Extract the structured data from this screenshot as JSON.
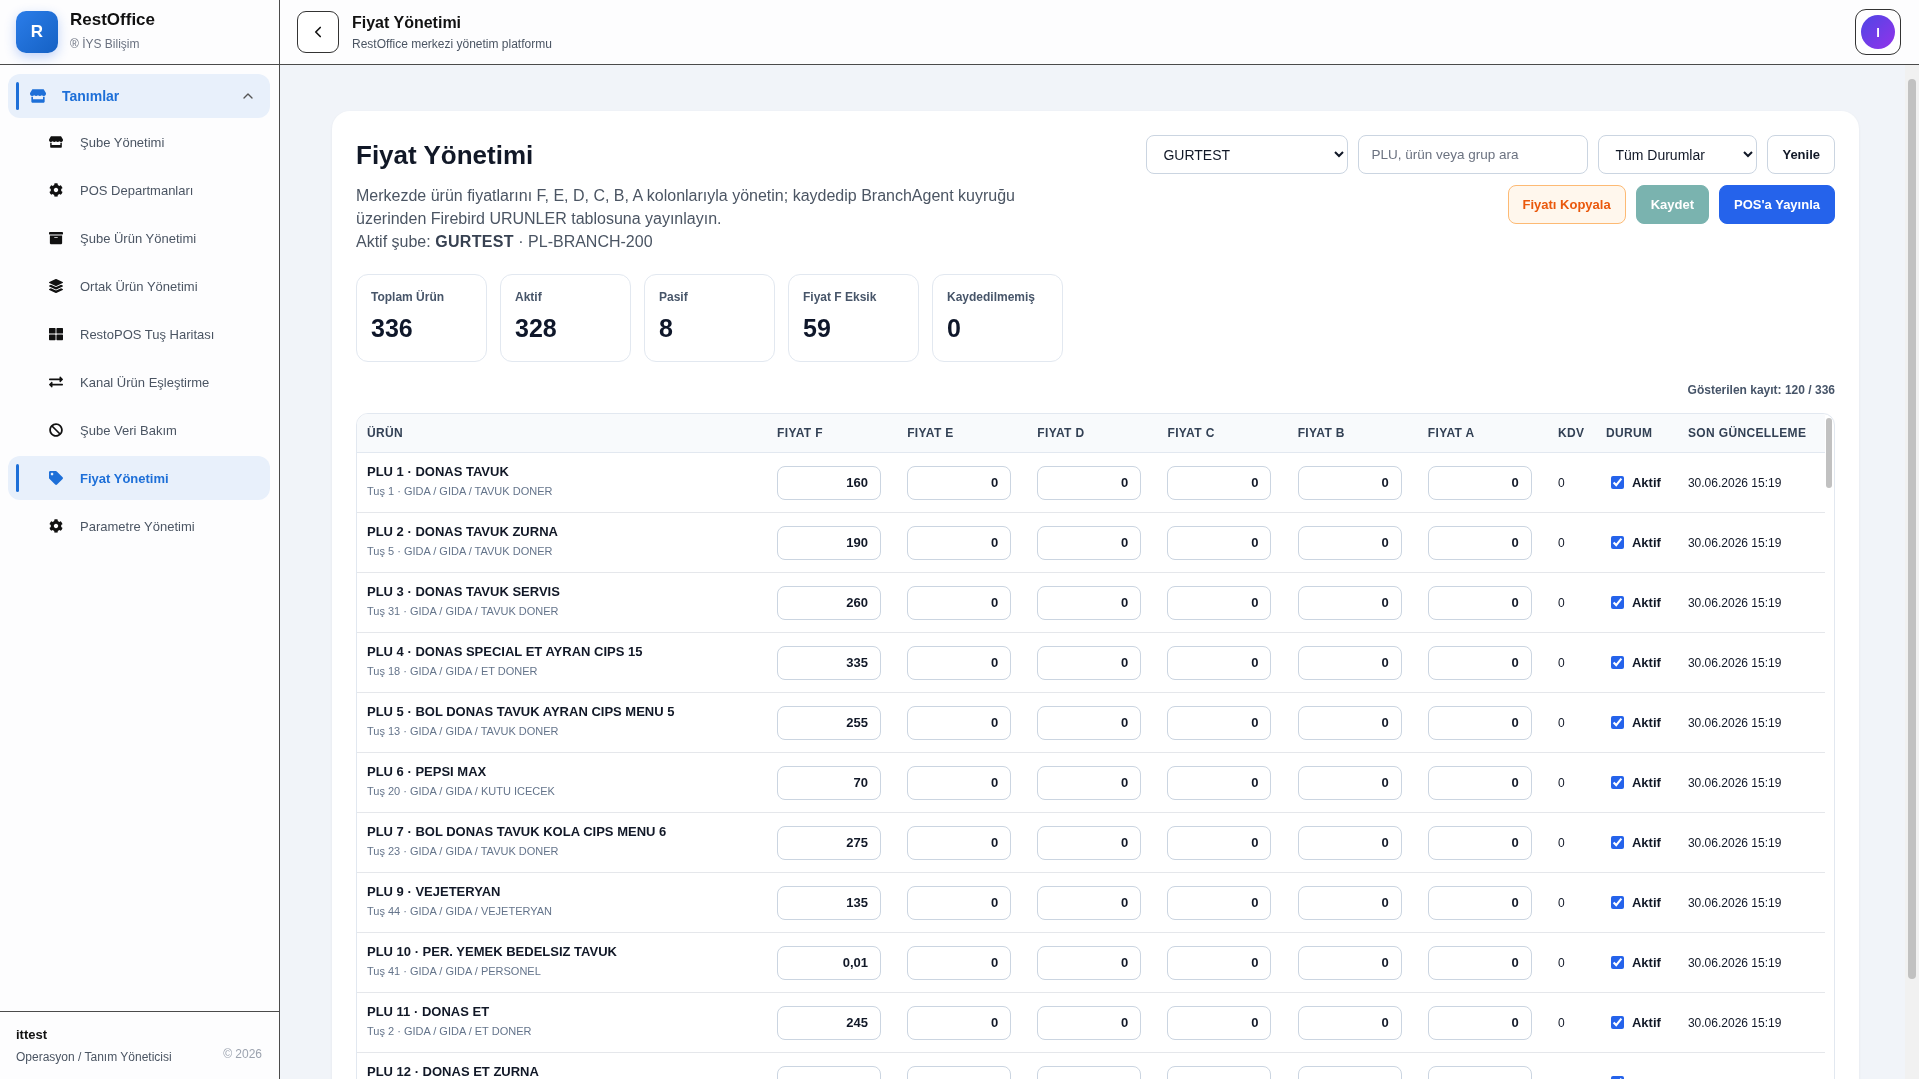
{
  "sidebar": {
    "brand": {
      "logo_letter": "R",
      "name": "RestOffice",
      "subtitle": "® İYS Bilişim"
    },
    "nav": [
      {
        "label": "Tanımlar",
        "selected": true,
        "expanded": true,
        "children": [
          {
            "label": "Şube Yönetimi",
            "selected": false
          },
          {
            "label": "POS Departmanları",
            "selected": false
          },
          {
            "label": "Şube Ürün Yönetimi",
            "selected": false
          },
          {
            "label": "Ortak Ürün Yönetimi",
            "selected": false
          },
          {
            "label": "RestoPOS Tuş Haritası",
            "selected": false
          },
          {
            "label": "Kanal Ürün Eşleştirme",
            "selected": false
          },
          {
            "label": "Şube Veri Bakım",
            "selected": false
          },
          {
            "label": "Fiyat Yönetimi",
            "selected": true
          },
          {
            "label": "Parametre Yönetimi",
            "selected": false
          }
        ]
      }
    ],
    "user": {
      "name": "ittest",
      "role": "Operasyon / Tanım Yöneticisi",
      "copyright": "© 2026"
    }
  },
  "topbar": {
    "title": "Fiyat Yönetimi",
    "subtitle": "RestOffice merkezi yönetim platformu",
    "avatar_initial": "I"
  },
  "page": {
    "title": "Fiyat Yönetimi",
    "description": "Merkezde ürün fiyatlarını F, E, D, C, B, A kolonlarıyla yönetin; kaydedip BranchAgent kuyruğu üzerinden Firebird URUNLER tablosuna yayınlayın.",
    "active_branch": "Aktif şube: **GURTEST** · PL-BRANCH-200",
    "filters": {
      "branch": "GURTEST",
      "search": {
        "placeholder": "PLU, ürün veya grup ara"
      },
      "status": "Tüm Durumlar",
      "refresh": "Yenile"
    },
    "actions": [
      {
        "label": "Fiyatı Kopyala",
        "kind": "outline",
        "disabled": false
      },
      {
        "label": "Kaydet",
        "kind": "success",
        "disabled": true
      },
      {
        "label": "POS'a Yayınla",
        "kind": "primary",
        "disabled": false
      }
    ],
    "stats": [
      {
        "label": "Toplam Ürün",
        "value": "336"
      },
      {
        "label": "Aktif",
        "value": "328"
      },
      {
        "label": "Pasif",
        "value": "8"
      },
      {
        "label": "Fiyat F Eksik",
        "value": "59"
      },
      {
        "label": "Kaydedilmemiş",
        "value": "0"
      }
    ],
    "record_count": "Gösterilen kayıt: 120 / 336",
    "table": {
      "columns": [
        "ÜRÜN",
        "FIYAT F",
        "FIYAT E",
        "FIYAT D",
        "FIYAT C",
        "FIYAT B",
        "FIYAT A",
        "KDV",
        "DURUM",
        "SON GÜNCELLEME"
      ],
      "rows": [
        {
          "name": "PLU 1 · DONAS TAVUK",
          "detail": "Tuş 1 · GIDA / GIDA / TAVUK DONER",
          "prices": [
            "160",
            "0",
            "0",
            "0",
            "0",
            "0"
          ],
          "kdv": "0",
          "checked": true,
          "status": "Aktif",
          "updated": "30.06.2026 15:19"
        },
        {
          "name": "PLU 2 · DONAS TAVUK ZURNA",
          "detail": "Tuş 5 · GIDA / GIDA / TAVUK DONER",
          "prices": [
            "190",
            "0",
            "0",
            "0",
            "0",
            "0"
          ],
          "kdv": "0",
          "checked": true,
          "status": "Aktif",
          "updated": "30.06.2026 15:19"
        },
        {
          "name": "PLU 3 · DONAS TAVUK SERVIS",
          "detail": "Tuş 31 · GIDA / GIDA / TAVUK DONER",
          "prices": [
            "260",
            "0",
            "0",
            "0",
            "0",
            "0"
          ],
          "kdv": "0",
          "checked": true,
          "status": "Aktif",
          "updated": "30.06.2026 15:19"
        },
        {
          "name": "PLU 4 · DONAS SPECIAL ET AYRAN CIPS 15",
          "detail": "Tuş 18 · GIDA / GIDA / ET DONER",
          "prices": [
            "335",
            "0",
            "0",
            "0",
            "0",
            "0"
          ],
          "kdv": "0",
          "checked": true,
          "status": "Aktif",
          "updated": "30.06.2026 15:19"
        },
        {
          "name": "PLU 5 · BOL DONAS TAVUK AYRAN CIPS MENU 5",
          "detail": "Tuş 13 · GIDA / GIDA / TAVUK DONER",
          "prices": [
            "255",
            "0",
            "0",
            "0",
            "0",
            "0"
          ],
          "kdv": "0",
          "checked": true,
          "status": "Aktif",
          "updated": "30.06.2026 15:19"
        },
        {
          "name": "PLU 6 · PEPSI MAX",
          "detail": "Tuş 20 · GIDA / GIDA / KUTU ICECEK",
          "prices": [
            "70",
            "0",
            "0",
            "0",
            "0",
            "0"
          ],
          "kdv": "0",
          "checked": true,
          "status": "Aktif",
          "updated": "30.06.2026 15:19"
        },
        {
          "name": "PLU 7 · BOL DONAS TAVUK KOLA CIPS MENU 6",
          "detail": "Tuş 23 · GIDA / GIDA / TAVUK DONER",
          "prices": [
            "275",
            "0",
            "0",
            "0",
            "0",
            "0"
          ],
          "kdv": "0",
          "checked": true,
          "status": "Aktif",
          "updated": "30.06.2026 15:19"
        },
        {
          "name": "PLU 9 · VEJETERYAN",
          "detail": "Tuş 44 · GIDA / GIDA / VEJETERYAN",
          "prices": [
            "135",
            "0",
            "0",
            "0",
            "0",
            "0"
          ],
          "kdv": "0",
          "checked": true,
          "status": "Aktif",
          "updated": "30.06.2026 15:19"
        },
        {
          "name": "PLU 10 · PER. YEMEK BEDELSIZ TAVUK",
          "detail": "Tuş 41 · GIDA / GIDA / PERSONEL",
          "prices": [
            "0,01",
            "0",
            "0",
            "0",
            "0",
            "0"
          ],
          "kdv": "0",
          "checked": true,
          "status": "Aktif",
          "updated": "30.06.2026 15:19"
        },
        {
          "name": "PLU 11 · DONAS ET",
          "detail": "Tuş 2 · GIDA / GIDA / ET DONER",
          "prices": [
            "245",
            "0",
            "0",
            "0",
            "0",
            "0"
          ],
          "kdv": "0",
          "checked": true,
          "status": "Aktif",
          "updated": "30.06.2026 15:19"
        },
        {
          "name": "PLU 12 · DONAS ET ZURNA",
          "checked": true
        }
      ]
    }
  }
}
